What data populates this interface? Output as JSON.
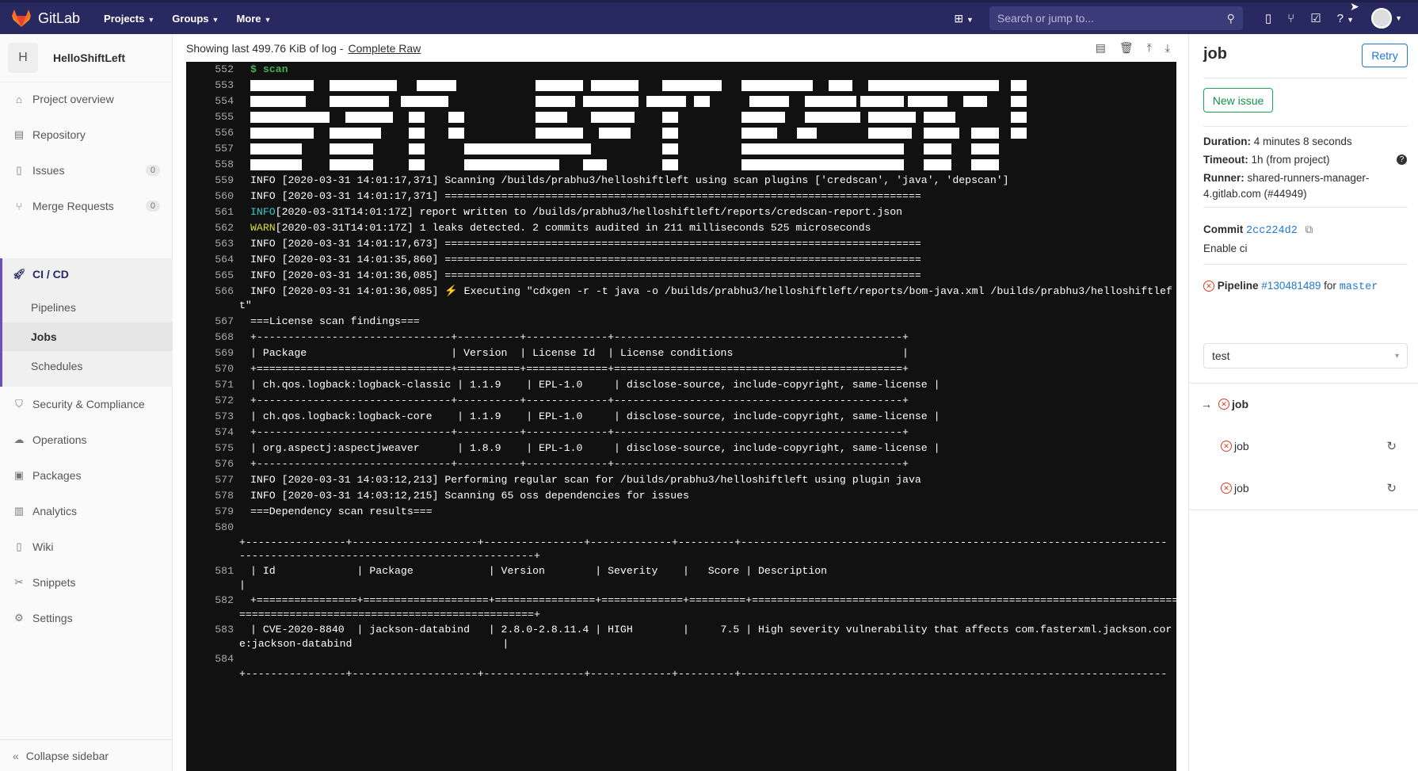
{
  "topbar": {
    "brand": "GitLab",
    "nav": [
      {
        "label": "Projects"
      },
      {
        "label": "Groups"
      },
      {
        "label": "More"
      }
    ],
    "search_placeholder": "Search or jump to..."
  },
  "sidebar": {
    "project_initial": "H",
    "project_name": "HelloShiftLeft",
    "items": [
      {
        "label": "Project overview",
        "icon": "home-icon"
      },
      {
        "label": "Repository",
        "icon": "doc-icon"
      },
      {
        "label": "Issues",
        "icon": "issues-icon",
        "count": "0"
      },
      {
        "label": "Merge Requests",
        "icon": "merge-request-icon",
        "count": "0"
      },
      {
        "label": "CI / CD",
        "icon": "rocket-icon"
      },
      {
        "label": "Security & Compliance",
        "icon": "shield-icon"
      },
      {
        "label": "Operations",
        "icon": "cloud-gear-icon"
      },
      {
        "label": "Packages",
        "icon": "package-icon"
      },
      {
        "label": "Analytics",
        "icon": "chart-icon"
      },
      {
        "label": "Wiki",
        "icon": "book-icon"
      },
      {
        "label": "Snippets",
        "icon": "scissors-icon"
      },
      {
        "label": "Settings",
        "icon": "gear-icon"
      }
    ],
    "cicd_sub": [
      {
        "label": "Pipelines"
      },
      {
        "label": "Jobs"
      },
      {
        "label": "Schedules"
      }
    ],
    "collapse_label": "Collapse sidebar"
  },
  "log_header": {
    "text": "Showing last 499.76 KiB of log -",
    "raw_link": "Complete Raw"
  },
  "log": {
    "lines": [
      {
        "n": "552",
        "t": "$ scan",
        "style": "green"
      },
      {
        "n": "553",
        "t": "",
        "style": "banner"
      },
      {
        "n": "554",
        "t": "",
        "style": "banner"
      },
      {
        "n": "555",
        "t": "",
        "style": "banner"
      },
      {
        "n": "556",
        "t": "",
        "style": "banner"
      },
      {
        "n": "557",
        "t": "",
        "style": "banner"
      },
      {
        "n": "558",
        "t": "",
        "style": "banner"
      },
      {
        "n": "559",
        "t": "INFO [2020-03-31 14:01:17,371] Scanning /builds/prabhu3/helloshiftleft using scan plugins ['credscan', 'java', 'depscan']"
      },
      {
        "n": "560",
        "t": "INFO [2020-03-31 14:01:17,371] ============================================================================"
      },
      {
        "n": "561",
        "prefix": "INFO",
        "prefix_style": "cyan",
        "t": "[2020-03-31T14:01:17Z] report written to /builds/prabhu3/helloshiftleft/reports/credscan-report.json"
      },
      {
        "n": "562",
        "prefix": "WARN",
        "prefix_style": "yellow",
        "t": "[2020-03-31T14:01:17Z] 1 leaks detected. 2 commits audited in 211 milliseconds 525 microseconds"
      },
      {
        "n": "563",
        "t": "INFO [2020-03-31 14:01:17,673] ============================================================================"
      },
      {
        "n": "564",
        "t": "INFO [2020-03-31 14:01:35,860] ============================================================================"
      },
      {
        "n": "565",
        "t": "INFO [2020-03-31 14:01:36,085] ============================================================================"
      },
      {
        "n": "566",
        "t": "INFO [2020-03-31 14:01:36,085] ⚡ Executing \"cdxgen -r -t java -o /builds/prabhu3/helloshiftleft/reports/bom-java.xml /builds/prabhu3/helloshiftlef",
        "cont": "t\""
      },
      {
        "n": "567",
        "t": "===License scan findings==="
      },
      {
        "n": "568",
        "t": "+-------------------------------+----------+-------------+----------------------------------------------+"
      },
      {
        "n": "569",
        "t": "| Package                       | Version  | License Id  | License conditions                           |"
      },
      {
        "n": "570",
        "t": "+===============================+==========+=============+==============================================+"
      },
      {
        "n": "571",
        "t": "| ch.qos.logback:logback-classic | 1.1.9    | EPL-1.0     | disclose-source, include-copyright, same-license |"
      },
      {
        "n": "572",
        "t": "+-------------------------------+----------+-------------+----------------------------------------------+"
      },
      {
        "n": "573",
        "t": "| ch.qos.logback:logback-core    | 1.1.9    | EPL-1.0     | disclose-source, include-copyright, same-license |"
      },
      {
        "n": "574",
        "t": "+-------------------------------+----------+-------------+----------------------------------------------+"
      },
      {
        "n": "575",
        "t": "| org.aspectj:aspectjweaver      | 1.8.9    | EPL-1.0     | disclose-source, include-copyright, same-license |"
      },
      {
        "n": "576",
        "t": "+-------------------------------+----------+-------------+----------------------------------------------+"
      },
      {
        "n": "577",
        "t": "INFO [2020-03-31 14:03:12,213] Performing regular scan for /builds/prabhu3/helloshiftleft using plugin java"
      },
      {
        "n": "578",
        "t": "INFO [2020-03-31 14:03:12,215] Scanning 65 oss dependencies for issues"
      },
      {
        "n": "579",
        "t": "===Dependency scan results==="
      },
      {
        "n": "580",
        "t": ""
      },
      {
        "n": "581",
        "t": "| Id             | Package            | Version        | Severity    |   Score | Description",
        "cont": "|"
      },
      {
        "n": "582",
        "t": "+================+====================+================+=============+=========+=====================================================================",
        "cont": "===============================================+"
      },
      {
        "n": "583",
        "t": "| CVE-2020-8840  | jackson-databind   | 2.8.0-2.8.11.4 | HIGH        |     7.5 | High severity vulnerability that affects com.fasterxml.jackson.cor",
        "cont": "e:jackson-databind                        |"
      },
      {
        "n": "584",
        "t": ""
      }
    ],
    "sep_580a": "+----------------+--------------------+----------------+-------------+---------+--------------------------------------------------------------------",
    "sep_580b": "-----------------------------------------------+",
    "sep_584": "+----------------+--------------------+----------------+-------------+---------+--------------------------------------------------------------------"
  },
  "right": {
    "title": "job",
    "retry": "Retry",
    "new_issue": "New issue",
    "duration_label": "Duration:",
    "duration_value": "4 minutes 8 seconds",
    "timeout_label": "Timeout:",
    "timeout_value": "1h (from project)",
    "runner_label": "Runner:",
    "runner_value": "shared-runners-manager-4.gitlab.com (#44949)",
    "commit_label": "Commit",
    "commit_sha": "2cc224d2",
    "commit_msg": "Enable ci",
    "pipeline_label": "Pipeline",
    "pipeline_id": "#130481489",
    "pipeline_for": "for",
    "pipeline_branch": "master",
    "stage": "test",
    "jobs": [
      {
        "name": "job",
        "current": true
      },
      {
        "name": "job",
        "current": false
      },
      {
        "name": "job",
        "current": false
      }
    ]
  },
  "colors": {
    "topbar": "#292961",
    "accent": "#6b4fbb",
    "link": "#1f78d1",
    "success": "#1aaa55",
    "failed": "#db3b21"
  }
}
